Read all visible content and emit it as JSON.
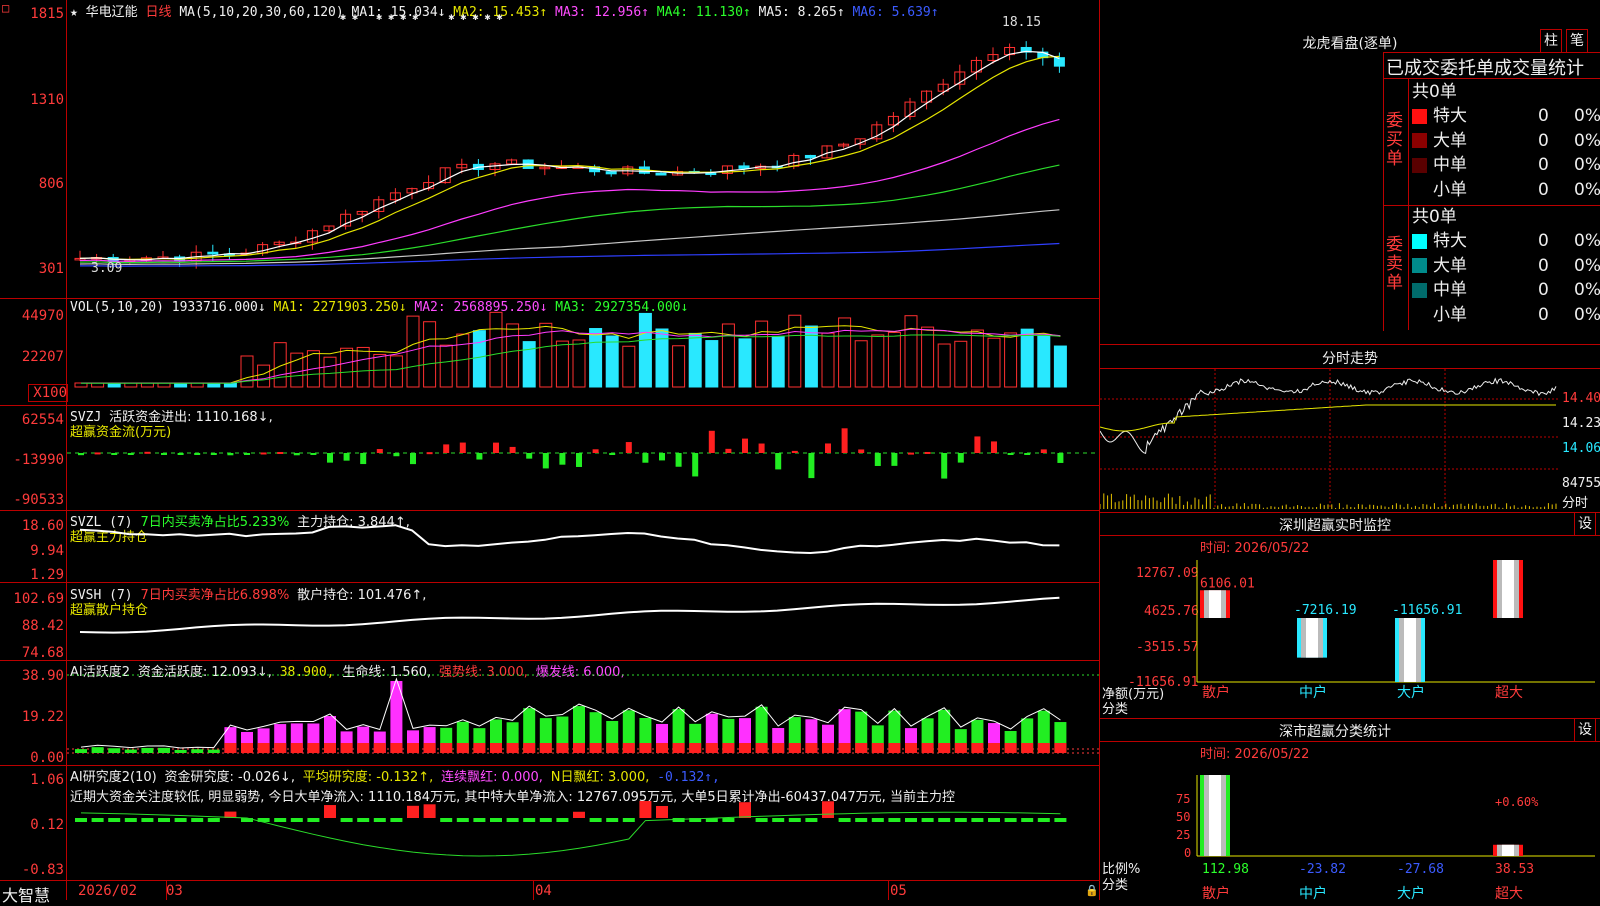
{
  "main": {
    "star": "★",
    "stock_name": "华电辽能",
    "period": "日线",
    "ma_params": "MA(5,10,20,30,60,120)",
    "ma1": "MA1: 15.034↓",
    "ma2": "MA2: 15.453↑",
    "ma3": "MA3: 12.956↑",
    "ma4": "MA4: 11.130↑",
    "ma5": "MA5: 8.265↑",
    "ma6": "MA6: 5.639↑",
    "high_label": "18.15",
    "low_label": "3.09",
    "axis": [
      "1815",
      "1310",
      "806",
      "301"
    ],
    "stars": "✱ ✱   ✱ ✱ ✱ ✱     ✱ ✱ ✱ ✱ ✱"
  },
  "vol": {
    "label": "VOL(5,10,20)",
    "value": "1933716.000↓",
    "ma1": "MA1: 2271903.250↓",
    "ma2": "MA2: 2568895.250↓",
    "ma3": "MA3: 2927354.000↓",
    "axis": [
      "44970",
      "22207",
      "X100"
    ]
  },
  "svzj": {
    "label": "SVZJ",
    "text": "活跃资金进出: 1110.168↓,",
    "sub": "超赢资金流(万元)",
    "axis": [
      "62554",
      "-13990",
      "-90533"
    ]
  },
  "svzl": {
    "label": "SVZL (7)",
    "text1": "7日内买卖净占比5.233%",
    "text2": "主力持仓: 3.844↑,",
    "sub": "超赢主力持仓",
    "axis": [
      "18.60",
      "9.94",
      "1.29"
    ]
  },
  "svsh": {
    "label": "SVSH (7)",
    "text1": "7日内买卖净占比6.898%",
    "text2": "散户持仓: 101.476↑,",
    "sub": "超赢散户持仓",
    "axis": [
      "102.69",
      "88.42",
      "74.68"
    ]
  },
  "ai1": {
    "label": "AI活跃度2",
    "t1": "资金活跃度: 12.093↓,",
    "t2": "38.900,",
    "t3": "生命线: 1.560,",
    "t4": "强势线: 3.000,",
    "t5": "爆发线: 6.000,",
    "axis": [
      "38.90",
      "19.22",
      "0.00"
    ]
  },
  "ai2": {
    "label": "AI研究度2(10)",
    "t1": "资金研究度: -0.026↓,",
    "t2": "平均研究度: -0.132↑,",
    "t3": "连续飘红: 0.000,",
    "t4": "N日飘红: 3.000,",
    "t5": "-0.132↑,",
    "note": "近期大资金关注度较低, 明显弱势, 今日大单净流入: 1110.184万元, 其中特大单净流入: 12767.095万元, 大单5日累计净出-60437.047万元, 当前主力控",
    "axis": [
      "1.06",
      "0.12",
      "-0.83"
    ]
  },
  "bottom": {
    "brand": "大智慧",
    "dates": [
      "2026/02",
      "03",
      "04",
      "05"
    ]
  },
  "right": {
    "lhb_title": "龙虎看盘(逐单)",
    "btn_zhu": "柱",
    "btn_bi": "笔",
    "stat_header": "已成交委托单成交量统计",
    "buy": {
      "group_label": "委买单",
      "total": "共0单",
      "rows": [
        {
          "name": "特大",
          "val": "0",
          "pct": "0%",
          "color": "#ff1010"
        },
        {
          "name": "大单",
          "val": "0",
          "pct": "0%",
          "color": "#8b0000"
        },
        {
          "name": "中单",
          "val": "0",
          "pct": "0%",
          "color": "#5a0000"
        },
        {
          "name": "小单",
          "val": "0",
          "pct": "0%",
          "color": "#000000"
        }
      ]
    },
    "sell": {
      "group_label": "委卖单",
      "total": "共0单",
      "rows": [
        {
          "name": "特大",
          "val": "0",
          "pct": "0%",
          "color": "#00ffff"
        },
        {
          "name": "大单",
          "val": "0",
          "pct": "0%",
          "color": "#008b8b"
        },
        {
          "name": "中单",
          "val": "0",
          "pct": "0%",
          "color": "#006b6b"
        },
        {
          "name": "小单",
          "val": "0",
          "pct": "0%",
          "color": "#000000"
        }
      ]
    },
    "intraday": {
      "title": "分时走势",
      "p1": "14.40",
      "p2": "14.23",
      "p3": "14.06",
      "vol": "84755",
      "vol_unit": "分时"
    },
    "sz_monitor": {
      "title": "深圳超赢实时监控",
      "btn": "设",
      "time": "时间: 2026/05/22",
      "axis": [
        "12767.09",
        "4625.76",
        "-3515.57",
        "-11656.91"
      ],
      "ylabel": "净额(万元)",
      "xlabel": "分类",
      "cats": [
        "散户",
        "中户",
        "大户",
        "超大"
      ],
      "values": [
        6106.01,
        -7216.19,
        -11656.91,
        12767.09
      ],
      "value_labels": [
        "6106.01",
        "-7216.19",
        "-11656.91",
        "12767.09"
      ]
    },
    "sz_class": {
      "title": "深市超赢分类统计",
      "btn": "设",
      "time": "时间: 2026/05/22",
      "axis": [
        "75",
        "50",
        "25",
        "0"
      ],
      "ylabel": "比例%",
      "xlabel": "分类",
      "cats": [
        "散户",
        "中户",
        "大户",
        "超大"
      ],
      "values": [
        112.98,
        -23.82,
        -27.68,
        38.53
      ],
      "value_labels": [
        "112.98",
        "-23.82",
        "-27.68",
        "38.53"
      ],
      "bar_note": "+0.60%"
    }
  },
  "chart_data": [
    {
      "type": "line",
      "title": "华电辽能 日线",
      "series": [
        {
          "name": "MA1",
          "values": [
            3.2,
            3.25,
            3.3,
            3.5,
            4.2,
            5.6,
            7.1,
            8.5,
            9.1,
            8.9,
            8.7,
            8.5,
            8.6,
            8.9,
            9.4,
            10.5,
            12.5,
            14.8,
            16.6,
            15.03
          ]
        }
      ]
    },
    {
      "type": "bar",
      "title": "深圳超赢实时监控",
      "categories": [
        "散户",
        "中户",
        "大户",
        "超大"
      ],
      "values": [
        6106.01,
        -7216.19,
        -11656.91,
        12767.09
      ],
      "ylabel": "净额(万元)",
      "xlabel": "分类",
      "ylim": [
        -11656.91,
        12767.09
      ]
    },
    {
      "type": "bar",
      "title": "深市超赢分类统计",
      "categories": [
        "散户",
        "中户",
        "大户",
        "超大"
      ],
      "values": [
        112.98,
        -23.82,
        -27.68,
        38.53
      ],
      "ylabel": "比例%",
      "xlabel": "分类",
      "ylim": [
        0,
        75
      ]
    }
  ]
}
